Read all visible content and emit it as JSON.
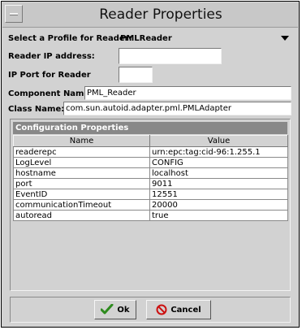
{
  "window": {
    "title": "Reader Properties"
  },
  "form": {
    "profile_label": "Select a Profile for Reader:",
    "profile_value": "PMLReader",
    "ip_label": "Reader IP address:",
    "ip_value": "",
    "port_label": "IP Port for Reader",
    "port_value": "",
    "component_label": "Component Name:",
    "component_value": "PML_Reader",
    "class_label": "Class Name:",
    "class_value": "com.sun.autoid.adapter.pml.PMLAdapter"
  },
  "properties": {
    "title": "Configuration Properties",
    "columns": [
      "Name",
      "Value"
    ],
    "rows": [
      {
        "name": "readerepc",
        "value": "urn:epc:tag:cid-96:1.255.1"
      },
      {
        "name": "LogLevel",
        "value": "CONFIG"
      },
      {
        "name": "hostname",
        "value": "localhost"
      },
      {
        "name": "port",
        "value": "9011"
      },
      {
        "name": "EventID",
        "value": "12551"
      },
      {
        "name": "communicationTimeout",
        "value": "20000"
      },
      {
        "name": "autoread",
        "value": "true"
      }
    ]
  },
  "buttons": {
    "ok_label": "Ok",
    "cancel_label": "Cancel"
  },
  "icons": {
    "window_menu": "window-menu-icon",
    "dropdown": "chevron-down-icon",
    "ok": "check-icon",
    "cancel": "prohibited-icon"
  },
  "colors": {
    "ok_icon": "#2e8b1e",
    "cancel_icon": "#cc1111",
    "panel_header": "#888888"
  }
}
